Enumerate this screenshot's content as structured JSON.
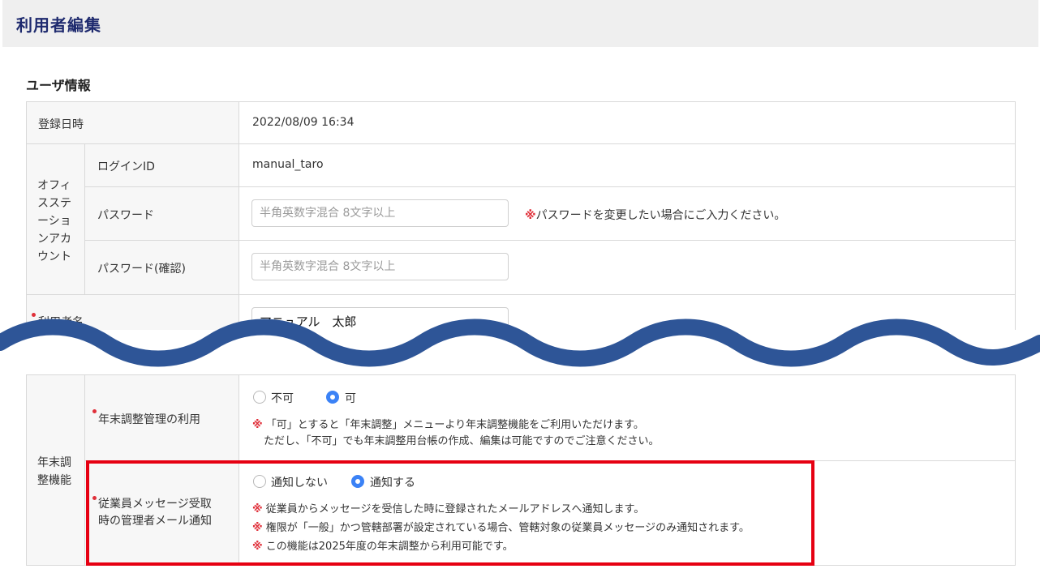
{
  "header": {
    "title": "利用者編集"
  },
  "section": {
    "title": "ユーザ情報"
  },
  "rows": {
    "registered": {
      "label": "登録日時",
      "value": "2022/08/09 16:34"
    },
    "account_group": {
      "label_lines": [
        "オフィ",
        "スステ",
        "ーショ",
        "ンアカ",
        "ウント"
      ]
    },
    "login_id": {
      "label": "ログインID",
      "value": "manual_taro"
    },
    "password": {
      "label": "パスワード",
      "placeholder": "半角英数字混合 8文字以上",
      "note_mark": "※",
      "note": "パスワードを変更したい場合にご入力ください。"
    },
    "password_confirm": {
      "label": "パスワード(確認)",
      "placeholder": "半角英数字混合 8文字以上"
    },
    "user_name": {
      "label": "利用者名",
      "value": "マニュアル　太郎"
    },
    "year_end_group": {
      "label_lines": [
        "年末調",
        "整機能"
      ]
    },
    "year_end_use": {
      "label": "年末調整管理の利用",
      "options": [
        "不可",
        "可"
      ],
      "selected": "可",
      "note_mark": "※",
      "note_line1": "「可」とすると「年末調整」メニューより年末調整機能をご利用いただけます。",
      "note_line2": "ただし、「不可」でも年末調整用台帳の作成、編集は可能ですのでご注意ください。"
    },
    "message_notify": {
      "label_lines": [
        "従業員メッセージ受取",
        "時の管理者メール通知"
      ],
      "options": [
        "通知しない",
        "通知する"
      ],
      "selected": "通知する",
      "notes": [
        {
          "mark": "※",
          "text": "従業員からメッセージを受信した時に登録されたメールアドレスへ通知します。"
        },
        {
          "mark": "※",
          "text": "権限が「一般」かつ管轄部署が設定されている場合、管轄対象の従業員メッセージのみ通知されます。"
        },
        {
          "mark": "※",
          "text": "この機能は2025年度の年末調整から利用可能です。"
        }
      ]
    }
  },
  "colors": {
    "title": "#1e2a6e",
    "required_dot": "#e0303a",
    "radio_selected": "#3b82f6",
    "wave": "#2e5597",
    "highlight_box": "#e60012"
  }
}
